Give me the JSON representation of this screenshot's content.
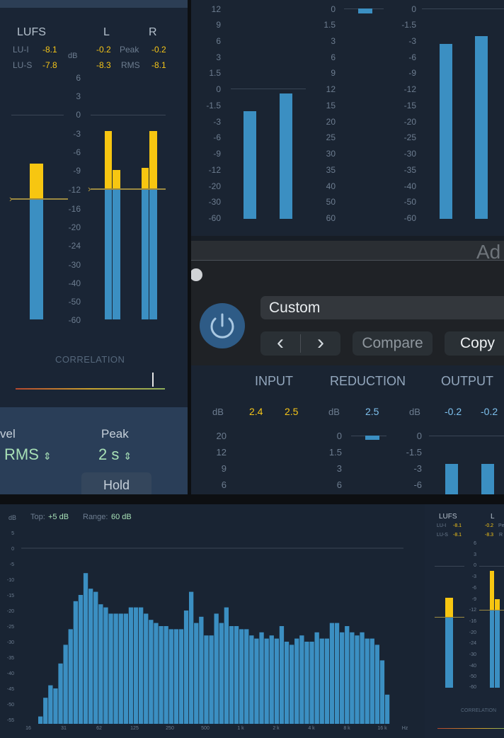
{
  "tl": {
    "lufs_header": "LUFS",
    "l_header": "L",
    "r_header": "R",
    "lu_i_label": "LU-I",
    "lu_i_value": "-8.1",
    "lu_s_label": "LU-S",
    "lu_s_value": "-7.8",
    "db_label": "dB",
    "l_peak": "-0.2",
    "peak_label": "Peak",
    "r_peak": "-0.2",
    "l_rms": "-8.3",
    "rms_label": "RMS",
    "r_rms": "-8.1",
    "scale": [
      "6",
      "3",
      "0",
      "-3",
      "-6",
      "-9",
      "-12",
      "-16",
      "-20",
      "-24",
      "-30",
      "-40",
      "-50",
      "-60"
    ],
    "correlation_label": "CORRELATION",
    "level_label": "vel",
    "level_value": "RMS",
    "peak_hold_label": "Peak",
    "peak_hold_value": "2 s",
    "hold_button": "Hold"
  },
  "tr": {
    "input_scale": [
      "12",
      "9",
      "6",
      "3",
      "1.5",
      "0",
      "-1.5",
      "-3",
      "-6",
      "-9",
      "-12",
      "-20",
      "-30",
      "-60"
    ],
    "reduction_scale": [
      "0",
      "1.5",
      "3",
      "6",
      "9",
      "12",
      "15",
      "20",
      "25",
      "30",
      "35",
      "40",
      "50",
      "60"
    ],
    "output_scale": [
      "0",
      "-1.5",
      "-3",
      "-6",
      "-9",
      "-12",
      "-15",
      "-20",
      "-25",
      "-30",
      "-35",
      "-40",
      "-50",
      "-60"
    ],
    "title_fragment": "Ad",
    "preset_name": "Custom",
    "prev_glyph": "‹",
    "next_glyph": "›",
    "compare_label": "Compare",
    "copy_label": "Copy",
    "input_label": "INPUT",
    "reduction_label": "REDUCTION",
    "output_label": "OUTPUT",
    "db_label": "dB",
    "input_l": "2.4",
    "input_r": "2.5",
    "reduction_value": "2.5",
    "output_l": "-0.2",
    "output_r": "-0.2",
    "input_mini_scale": [
      "20",
      "12",
      "9",
      "6"
    ],
    "reduction_mini_scale": [
      "0",
      "1.5",
      "3",
      "6"
    ],
    "output_mini_scale": [
      "0",
      "-1.5",
      "-3",
      "-6"
    ]
  },
  "bt": {
    "db_label": "dB",
    "top_label": "Top:",
    "top_value": "+5 dB",
    "range_label": "Range:",
    "range_value": "60 dB",
    "y_ticks": [
      "5",
      "0",
      "-5",
      "-10",
      "-15",
      "-20",
      "-25",
      "-30",
      "-35",
      "-40",
      "-45",
      "-50",
      "-55"
    ],
    "x_ticks": [
      "16",
      "31",
      "62",
      "125",
      "250",
      "500",
      "1 k",
      "2 k",
      "4 k",
      "8 k",
      "16 k"
    ],
    "x_unit": "Hz",
    "mini_lufs": "LUFS",
    "mini_l": "L",
    "mini_lu_i": "LU-I",
    "mini_lu_i_value": "-8.1",
    "mini_l_peak": "-0.2",
    "mini_peak_frag": "Pe",
    "mini_lu_s": "LU-S",
    "mini_lu_s_value": "-8.1",
    "mini_l_rms": "-8.3",
    "mini_rms_frag": "R",
    "mini_scale": [
      "6",
      "3",
      "0",
      "-3",
      "-6",
      "-9",
      "-12",
      "-16",
      "-20",
      "-24",
      "-30",
      "-40",
      "-50",
      "-60"
    ],
    "mini_correlation": "CORRELATION"
  },
  "chart_data": {
    "type": "bar",
    "y_unit": "dB",
    "ylim": [
      -55,
      5
    ],
    "x_ticks": [
      "16",
      "31",
      "62",
      "125",
      "250",
      "500",
      "1 k",
      "2 k",
      "4 k",
      "8 k",
      "16 k"
    ],
    "values": [
      -54,
      -48,
      -44,
      -45,
      -37,
      -31,
      -26,
      -17,
      -15,
      -8,
      -13,
      -14,
      -18,
      -19,
      -21,
      -21,
      -21,
      -21,
      -19,
      -19,
      -19,
      -21,
      -23,
      -24,
      -25,
      -25,
      -26,
      -26,
      -26,
      -20,
      -14,
      -24,
      -22,
      -28,
      -28,
      -21,
      -24,
      -19,
      -25,
      -25,
      -26,
      -26,
      -28,
      -29,
      -27,
      -29,
      -28,
      -29,
      -25,
      -30,
      -31,
      -29,
      -28,
      -30,
      -30,
      -27,
      -29,
      -29,
      -24,
      -24,
      -27,
      -25,
      -27,
      -28,
      -27,
      -29,
      -29,
      -31,
      -36,
      -47
    ]
  }
}
